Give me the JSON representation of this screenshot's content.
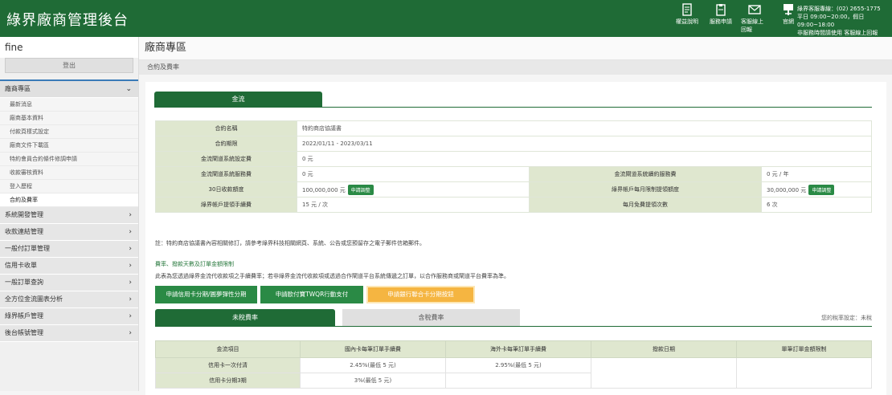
{
  "header": {
    "logo": "綠界廠商管理後台",
    "icons": [
      {
        "icon": "document-icon",
        "label": "權益說明"
      },
      {
        "icon": "form-icon",
        "label": "服務申請"
      },
      {
        "icon": "mail-icon",
        "label": "客服線上回報"
      },
      {
        "icon": "news-icon",
        "label": "官網"
      }
    ],
    "service_lines": [
      "綠界客服專線：(02) 2655-1775",
      "平日 09:00~20:00，假日09:00~18:00",
      "非服務時間請使用 客服線上回報"
    ]
  },
  "sidebar": {
    "user": "fine",
    "logout": "登出",
    "active_section": "廠商專區",
    "sub_items": [
      "最新消息",
      "廠商基本資料",
      "付款頁樣式設定",
      "廠商文件下載區",
      "特約會員合約條件修調申請",
      "收款審核資料",
      "登入歷程",
      "合約及費率"
    ],
    "selected_item": "合約及費率",
    "sections": [
      "系統開發管理",
      "收款連結管理",
      "一般付訂單管理",
      "信用卡收單",
      "一般訂單查詢",
      "全方位金流圖表分析",
      "綠界帳戶管理",
      "後台帳號管理"
    ]
  },
  "main": {
    "title": "廠商專區",
    "subtitle": "合約及費率",
    "tab": "金流",
    "contract": {
      "name_label": "合約名稱",
      "name_value": "特約商店協議書",
      "period_label": "合約期限",
      "period_value": "2022/01/11 - 2023/03/11",
      "setup_label": "金流閘道系統設定費",
      "setup_value": "0 元",
      "service_label": "金流閘道系統服務費",
      "service_value": "0 元",
      "annual_label": "金流閘道系統續約服務費",
      "annual_value": "0 元 / 年",
      "limit30_label": "30日收款額度",
      "limit30_value": "100,000,000 元",
      "monthly_label": "綠界帳戶每月限制提領額度",
      "monthly_value": "30,000,000 元",
      "apply_adjust": "申請調整",
      "withdraw_fee_label": "綠界帳戶提領手續費",
      "withdraw_fee_value": "15 元 / 次",
      "free_label": "每月免費提領次數",
      "free_value": "6 次"
    },
    "note": "註：特約商店協議書內容相關修訂，請參考綠界科技相關網頁、系統、公告或您預留存之電子郵件信箱郵件。",
    "section_title": "費率、撥款天數及訂單金額限制",
    "section_desc": "此表為您透過綠界金流代收款項之手續費率；若非綠界金流代收款項或透過合作閘道平台系統傳遞之訂單，以合作服務商或閘道平台費率為準。",
    "actions": [
      "申請信用卡分期/圓夢彈性分期",
      "申請歐付寶TWQR行動支付",
      "申請銀行聯合卡分期按鈕"
    ],
    "rate_tabs": [
      "未稅費率",
      "含稅費率"
    ],
    "tax_note": "您的稅率設定：未稅",
    "fee_headers": [
      "金流項目",
      "國內卡每筆訂單手續費",
      "海外卡每筆訂單手續費",
      "撥款日期",
      "單筆訂單金額限制"
    ],
    "fee_rows": [
      {
        "item": "信用卡一次付清",
        "domestic": "2.45%(最低 5 元)",
        "foreign": "2.95%(最低 5 元)"
      },
      {
        "item": "信用卡分期3期",
        "domestic": "3%(最低 5 元)",
        "foreign": ""
      }
    ]
  },
  "colors": {
    "brand": "#1f6b36",
    "accent_green": "#2a8a45",
    "orange": "#f5b541",
    "header_cell": "#dfe7cf"
  }
}
